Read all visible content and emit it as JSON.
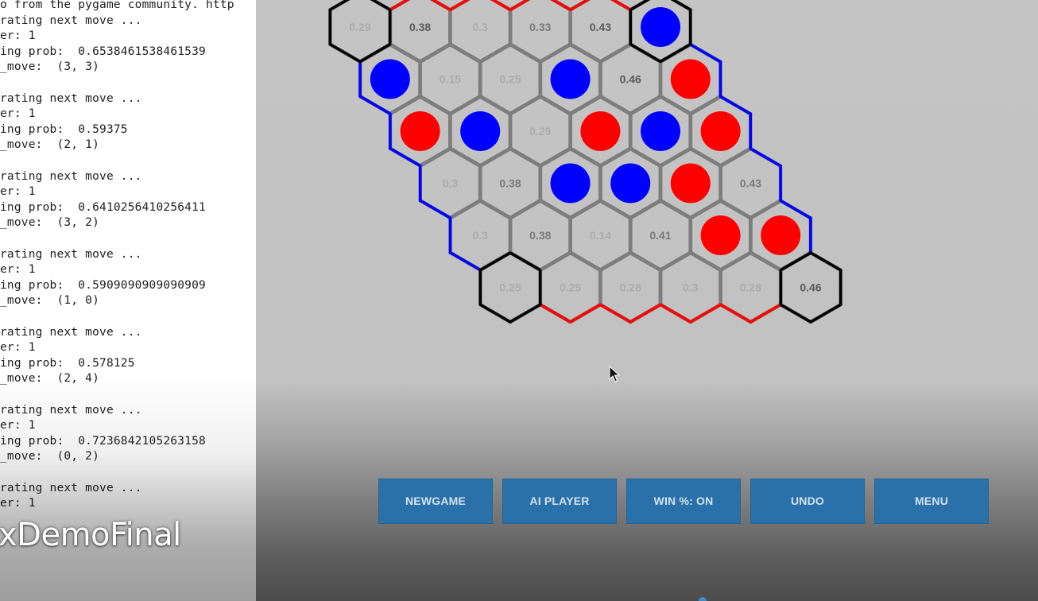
{
  "terminal": {
    "lines": [
      "o from the pygame community. http",
      "rating next move ...",
      "er: 1",
      "ing prob:  0.6538461538461539",
      "_move:  (3, 3)",
      "",
      "rating next move ...",
      "er: 1",
      "ing prob:  0.59375",
      "_move:  (2, 1)",
      "",
      "rating next move ...",
      "er: 1",
      "ing prob:  0.6410256410256411",
      "_move:  (3, 2)",
      "",
      "rating next move ...",
      "er: 1",
      "ing prob:  0.5909090909090909",
      "_move:  (1, 0)",
      "",
      "rating next move ...",
      "er: 1",
      "ing prob:  0.578125",
      "_move:  (2, 4)",
      "",
      "rating next move ...",
      "er: 1",
      "ing prob:  0.7236842105263158",
      "_move:  (0, 2)",
      "",
      "rating next move ...",
      "er: 1"
    ],
    "watermark": "xDemoFinal"
  },
  "board": {
    "colors": {
      "red": "#ff0000",
      "blue": "#0000ff",
      "grid": "#7d7d7d",
      "corner": "#000000",
      "background": "#c4c4c4"
    },
    "rows": [
      [
        {
          "label": "0.29",
          "tone": "faint"
        },
        {
          "label": "0.38",
          "tone": "dark"
        },
        {
          "label": "0.3",
          "tone": "faint"
        },
        {
          "label": "0.33",
          "tone": "mid"
        },
        {
          "label": "0.43",
          "tone": "dark"
        },
        {
          "piece": "blue"
        }
      ],
      [
        {
          "piece": "blue"
        },
        {
          "label": "0.15",
          "tone": "faint"
        },
        {
          "label": "0.25",
          "tone": "faint"
        },
        {
          "piece": "blue"
        },
        {
          "label": "0.46",
          "tone": "dark"
        },
        {
          "piece": "red"
        }
      ],
      [
        {
          "piece": "red"
        },
        {
          "piece": "blue"
        },
        {
          "label": "0.29",
          "tone": "faint"
        },
        {
          "piece": "red"
        },
        {
          "piece": "blue"
        },
        {
          "piece": "red"
        }
      ],
      [
        {
          "label": "0.3",
          "tone": "faint"
        },
        {
          "label": "0.38",
          "tone": "mid"
        },
        {
          "piece": "blue"
        },
        {
          "piece": "blue"
        },
        {
          "piece": "red"
        },
        {
          "label": "0.43",
          "tone": "mid"
        }
      ],
      [
        {
          "label": "0.3",
          "tone": "faint"
        },
        {
          "label": "0.38",
          "tone": "mid"
        },
        {
          "label": "0.14",
          "tone": "faint"
        },
        {
          "label": "0.41",
          "tone": "mid"
        },
        {
          "piece": "red"
        },
        {
          "piece": "red"
        }
      ],
      [
        {
          "label": "0.25",
          "tone": "faint"
        },
        {
          "label": "0.25",
          "tone": "faint"
        },
        {
          "label": "0.28",
          "tone": "faint"
        },
        {
          "label": "0.3",
          "tone": "faint"
        },
        {
          "label": "0.28",
          "tone": "faint"
        },
        {
          "label": "0.46",
          "tone": "dark"
        }
      ]
    ]
  },
  "buttons": {
    "new_game": "NEWGAME",
    "ai_player": "AI PLAYER",
    "win_pct": "WIN %: ON",
    "undo": "UNDO",
    "menu": "MENU"
  },
  "icons": {
    "cursor": "mouse-pointer-icon"
  }
}
